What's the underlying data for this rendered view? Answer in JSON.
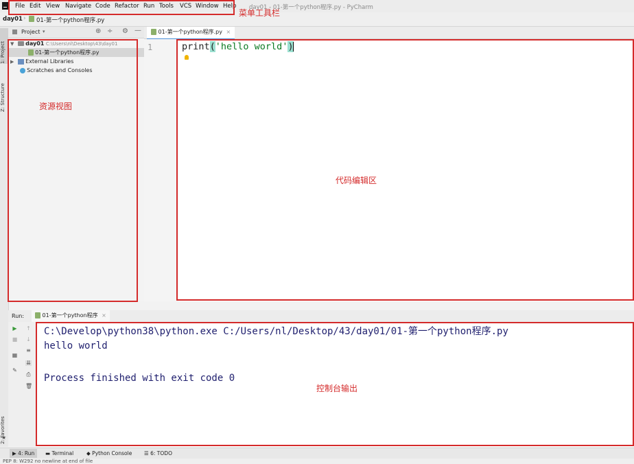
{
  "menubar": {
    "items": [
      "File",
      "Edit",
      "View",
      "Navigate",
      "Code",
      "Refactor",
      "Run",
      "Tools",
      "VCS",
      "Window",
      "Help"
    ],
    "window_title": "day01 - 01-第一个python程序.py - PyCharm"
  },
  "navbar": {
    "project": "day01",
    "file": "01-第一个python程序.py"
  },
  "left_strip": {
    "project_tab": "1: Project",
    "structure_tab": "Z: Structure",
    "favorites_tab": "2: Favorites"
  },
  "project_panel": {
    "title": "Project",
    "root_name": "day01",
    "root_path": "C:\\Users\\nl\\Desktop\\43\\day01",
    "file": "01-第一个python程序.py",
    "external_libraries": "External Libraries",
    "scratches": "Scratches and Consoles"
  },
  "editor": {
    "tab_label": "01-第一个python程序.py",
    "line_number": "1",
    "code": {
      "fn": "print",
      "open_paren": "(",
      "string": "'hello world'",
      "close_paren": ")"
    }
  },
  "run_panel": {
    "label": "Run:",
    "tab_label": "01-第一个python程序",
    "console_lines": [
      "C:\\Develop\\python38\\python.exe C:/Users/nl/Desktop/43/day01/01-第一个python程序.py",
      "hello world",
      "",
      "Process finished with exit code 0"
    ]
  },
  "bottom_tabs": [
    "4: Run",
    "Terminal",
    "Python Console",
    "6: TODO"
  ],
  "status_bar": "PEP 8: W292 no newline at end of file",
  "annotations": {
    "menu_toolbar": "菜单工具栏",
    "resource_view": "资源视图",
    "code_editor": "代码编辑区",
    "console_output": "控制台输出"
  }
}
